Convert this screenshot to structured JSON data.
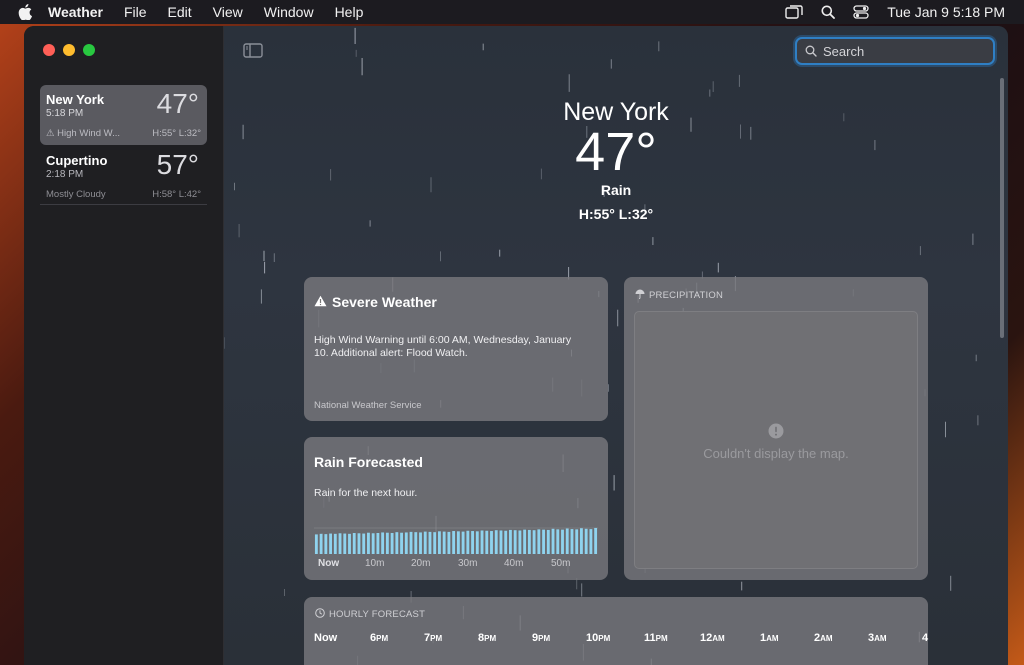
{
  "menubar": {
    "apple_icon": "apple-logo",
    "app_name": "Weather",
    "menus": [
      "File",
      "Edit",
      "View",
      "Window",
      "Help"
    ],
    "datetime": "Tue Jan 9  5:18 PM",
    "status_icons": [
      "screen-mirroring-icon",
      "search-icon",
      "control-center-icon"
    ]
  },
  "sidebar": {
    "locations": [
      {
        "name": "New York",
        "time": "5:18 PM",
        "temp": "47°",
        "condition": "High Wind W...",
        "hilo": "H:55°  L:32°",
        "selected": true
      },
      {
        "name": "Cupertino",
        "time": "2:18 PM",
        "temp": "57°",
        "condition": "Mostly Cloudy",
        "hilo": "H:58°  L:42°",
        "selected": false
      }
    ]
  },
  "search": {
    "placeholder": "Search"
  },
  "current": {
    "city": "New York",
    "temp": "47°",
    "condition": "Rain",
    "hilo": "H:55°  L:32°"
  },
  "severe": {
    "title": "Severe Weather",
    "body": "High Wind Warning until 6:00 AM, Wednesday, January 10. Additional alert: Flood Watch.",
    "source": "National Weather Service"
  },
  "rain_forecast": {
    "title": "Rain Forecasted",
    "body": "Rain for the next hour.",
    "axis": [
      "Now",
      "10m",
      "20m",
      "30m",
      "40m",
      "50m"
    ],
    "intensity": [
      0.7,
      0.72,
      0.71,
      0.73,
      0.72,
      0.74,
      0.73,
      0.72,
      0.75,
      0.74,
      0.73,
      0.76,
      0.74,
      0.75,
      0.77,
      0.76,
      0.75,
      0.78,
      0.76,
      0.77,
      0.79,
      0.78,
      0.77,
      0.8,
      0.79,
      0.78,
      0.81,
      0.8,
      0.79,
      0.82,
      0.81,
      0.8,
      0.83,
      0.82,
      0.81,
      0.84,
      0.83,
      0.82,
      0.85,
      0.84,
      0.83,
      0.86,
      0.85,
      0.84,
      0.87,
      0.86,
      0.85,
      0.88,
      0.87,
      0.86,
      0.9,
      0.88,
      0.87,
      0.91,
      0.89,
      0.88,
      0.92,
      0.9,
      0.89,
      0.93
    ]
  },
  "precipitation": {
    "label": "PRECIPITATION",
    "error_message": "Couldn't display the map."
  },
  "hourly": {
    "label": "HOURLY FORECAST",
    "hours": [
      {
        "h": "Now",
        "suffix": ""
      },
      {
        "h": "6",
        "suffix": "PM"
      },
      {
        "h": "7",
        "suffix": "PM"
      },
      {
        "h": "8",
        "suffix": "PM"
      },
      {
        "h": "9",
        "suffix": "PM"
      },
      {
        "h": "10",
        "suffix": "PM"
      },
      {
        "h": "11",
        "suffix": "PM"
      },
      {
        "h": "12",
        "suffix": "AM"
      },
      {
        "h": "1",
        "suffix": "AM"
      },
      {
        "h": "2",
        "suffix": "AM"
      },
      {
        "h": "3",
        "suffix": "AM"
      },
      {
        "h": "4",
        "suffix": ""
      }
    ]
  }
}
